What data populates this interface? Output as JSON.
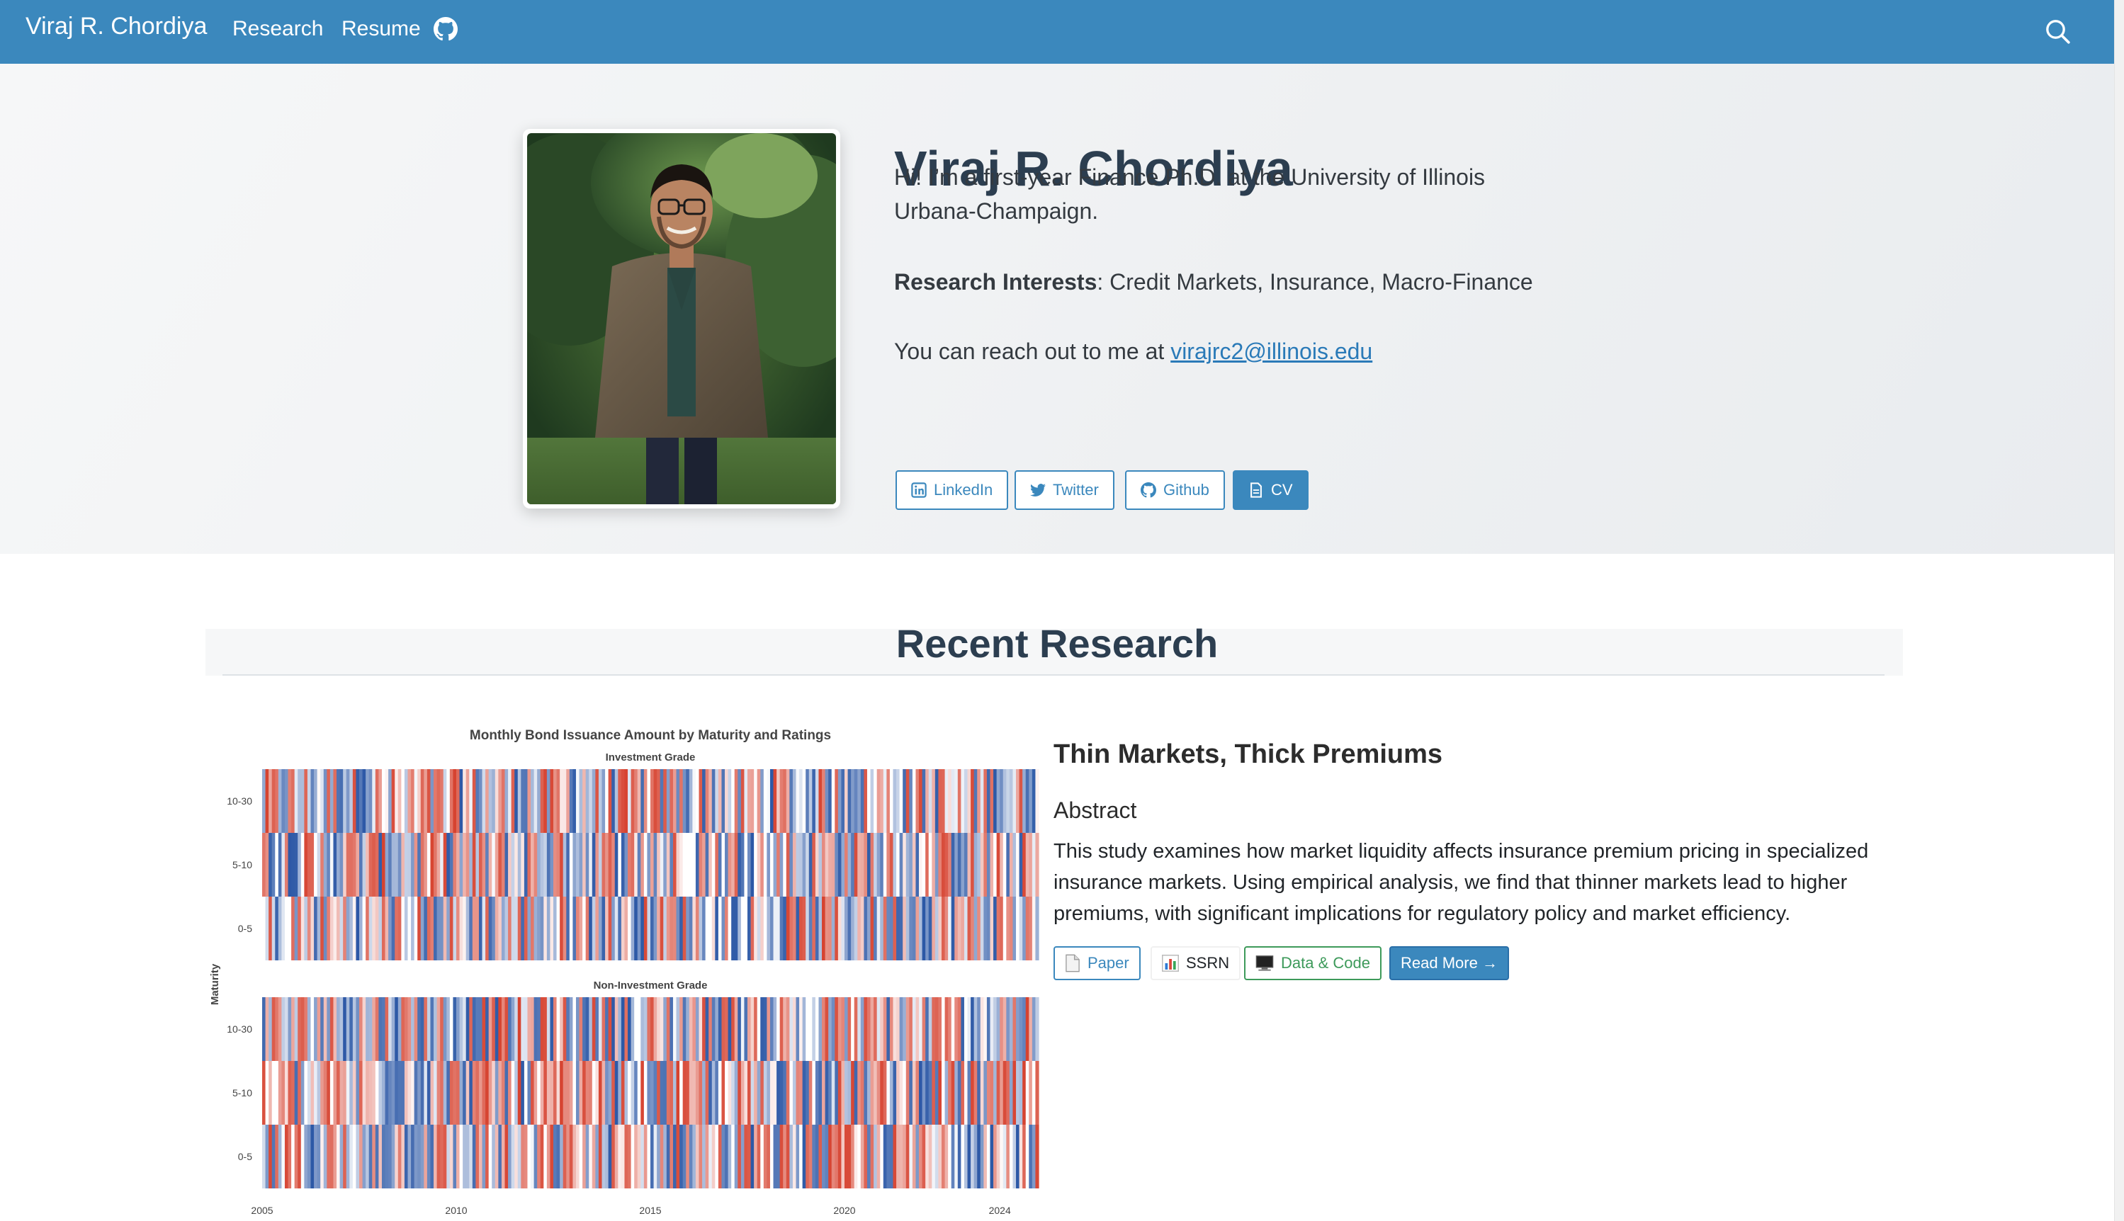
{
  "navbar": {
    "brand": "Viraj R. Chordiya",
    "links": [
      "Research",
      "Resume"
    ],
    "github_icon": "github-icon",
    "search_icon": "search-icon",
    "background": "#3b88bd"
  },
  "hero": {
    "name": "Viraj R. Chordiya",
    "intro": "Hi! I’m a first-year Finance Ph.D. at the University of Illinois Urbana-Champaign.",
    "interests_label": "Research Interests",
    "interests": ": Credit Markets, Insurance, Macro-Finance",
    "contact_prefix": "You can reach out to me at ",
    "email": "virajrc2@illinois.edu",
    "buttons": [
      {
        "label": "LinkedIn",
        "icon": "linkedin-icon"
      },
      {
        "label": "Twitter",
        "icon": "twitter-icon"
      },
      {
        "label": "Github",
        "icon": "github-icon"
      },
      {
        "label": "CV",
        "icon": "file-icon"
      }
    ]
  },
  "research": {
    "section_title": "Recent Research",
    "paper_title": "Thin Markets, Thick Premiums",
    "abstract_heading": "Abstract",
    "abstract": "This study examines how market liquidity affects insurance premium pricing in specialized insurance markets. Using empirical analysis, we find that thinner markets lead to higher premiums, with significant implications for regulatory policy and market efficiency.",
    "buttons": [
      {
        "label": "Paper",
        "icon": "document-icon"
      },
      {
        "label": "SSRN",
        "icon": "bar-chart-icon"
      },
      {
        "label": "Data & Code",
        "icon": "computer-icon"
      },
      {
        "label": "Read More →"
      }
    ]
  },
  "chart_data": {
    "type": "heatmap",
    "title": "Monthly Bond Issuance Amount by Maturity and Ratings",
    "panels": [
      "Investment Grade",
      "Non-Investment Grade"
    ],
    "ylabel": "Maturity",
    "y_categories": [
      "10-30",
      "5-10",
      "0-5"
    ],
    "x_ticks": [
      "2005",
      "2010",
      "2015",
      "2020",
      "2024"
    ],
    "x_range": [
      "2005-01",
      "2024-12"
    ],
    "colormap": [
      "#2c58a6",
      "#ffffff",
      "#d6422f"
    ]
  }
}
